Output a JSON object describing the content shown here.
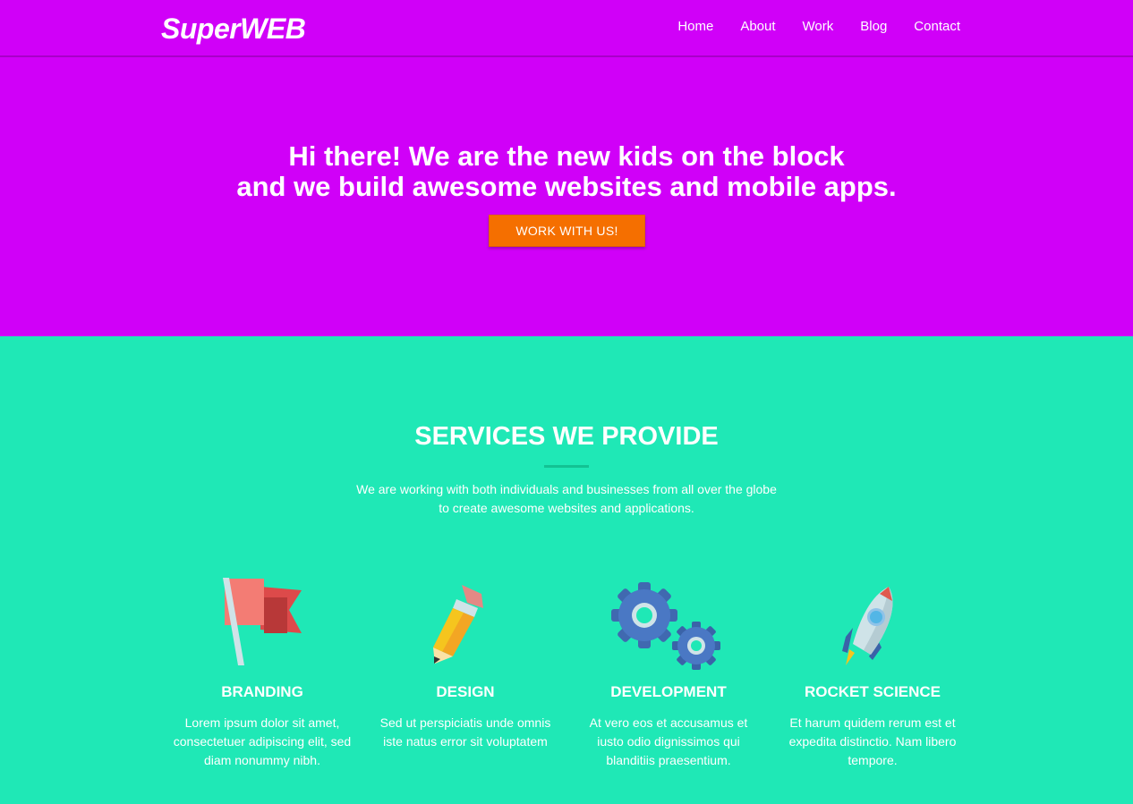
{
  "header": {
    "logo": "SuperWEB",
    "nav": [
      {
        "label": "Home"
      },
      {
        "label": "About"
      },
      {
        "label": "Work"
      },
      {
        "label": "Blog"
      },
      {
        "label": "Contact"
      }
    ]
  },
  "hero": {
    "headline_line1": "Hi there! We are the new kids on the block",
    "headline_line2": "and we build awesome websites and mobile apps.",
    "cta_label": "WORK WITH US!"
  },
  "services": {
    "title": "SERVICES WE PROVIDE",
    "intro_line1": "We are working with both individuals and businesses from all over the globe",
    "intro_line2": "to create awesome websites and applications.",
    "items": [
      {
        "icon": "flag-icon",
        "title": "BRANDING",
        "text": "Lorem ipsum dolor sit amet, consectetuer adipiscing elit, sed diam nonummy nibh."
      },
      {
        "icon": "pencil-icon",
        "title": "DESIGN",
        "text": "Sed ut perspiciatis unde omnis iste natus error sit voluptatem"
      },
      {
        "icon": "gears-icon",
        "title": "DEVELOPMENT",
        "text": "At vero eos et accusamus et iusto odio dignissimos qui blanditiis praesentium."
      },
      {
        "icon": "rocket-icon",
        "title": "ROCKET SCIENCE",
        "text": "Et harum quidem rerum est et expedita distinctio. Nam libero tempore."
      }
    ]
  },
  "colors": {
    "hero_bg": "#d000f8",
    "services_bg": "#1fe8b6",
    "cta": "#f56f00"
  }
}
